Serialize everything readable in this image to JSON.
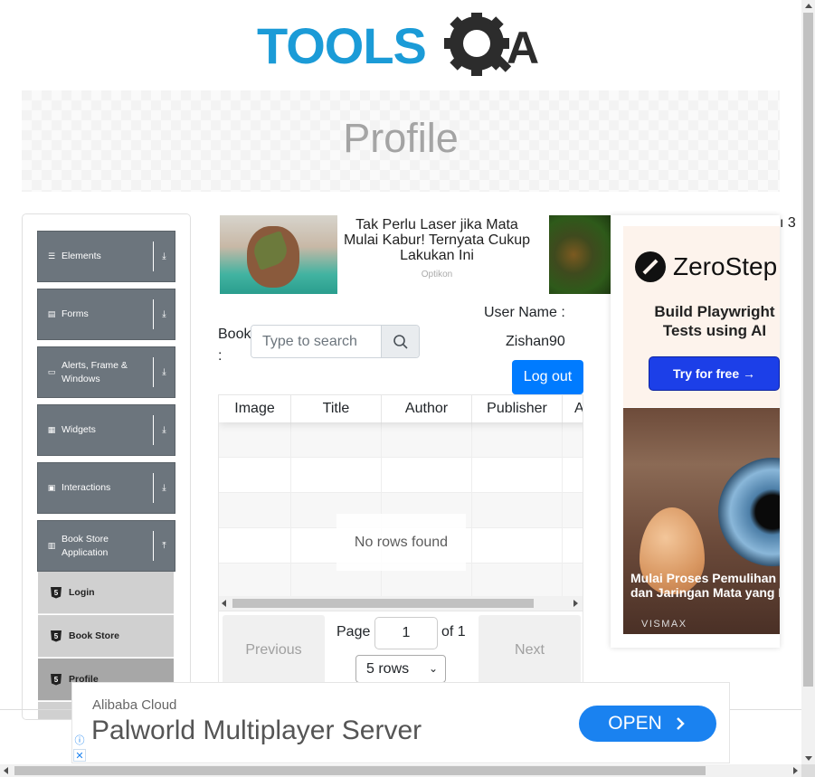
{
  "brand": {
    "logo_text_part1": "TOOLS",
    "logo_text_part2": "QA",
    "logo_color_primary": "#1b9bd7",
    "logo_color_gear": "#2c2c2c"
  },
  "page": {
    "title": "Profile"
  },
  "sidebar": {
    "groups": [
      {
        "label": "Elements",
        "icon": "menu-lines-icon",
        "arrow": "download-arrow-icon"
      },
      {
        "label": "Forms",
        "icon": "form-icon",
        "arrow": "download-arrow-icon"
      },
      {
        "label": "Alerts, Frame & Windows",
        "icon": "window-icon",
        "arrow": "download-arrow-icon"
      },
      {
        "label": "Widgets",
        "icon": "grid-icon",
        "arrow": "download-arrow-icon"
      },
      {
        "label": "Interactions",
        "icon": "box-icon",
        "arrow": "download-arrow-icon"
      },
      {
        "label": "Book Store Application",
        "icon": "books-icon",
        "arrow": "upload-arrow-icon"
      }
    ],
    "book_store_items": [
      {
        "label": "Login",
        "active": false
      },
      {
        "label": "Book Store",
        "active": false
      },
      {
        "label": "Profile",
        "active": true
      }
    ]
  },
  "top_ad": {
    "headline": "Tak Perlu Laser jika Mata Mulai Kabur! Ternyata Cukup Lakukan Ini",
    "source": "Optikon",
    "partial_edge_text": "3"
  },
  "profile": {
    "books_label": "Book :",
    "search_placeholder": "Type to search",
    "user_name_label": "User Name :",
    "user_name_value": "Zishan90",
    "logout_label": "Log out"
  },
  "table": {
    "columns": [
      "Image",
      "Title",
      "Author",
      "Publisher",
      "A"
    ],
    "rows": [],
    "empty_message": "No rows found"
  },
  "pagination": {
    "previous_label": "Previous",
    "next_label": "Next",
    "page_label": "Page",
    "page_value": "1",
    "of_label": "of 1",
    "rows_selected": "5 rows"
  },
  "right_ad": {
    "brand": "ZeroStep",
    "tagline": "Build Playwright Tests using AI",
    "cta": "Try for free →",
    "image_caption_line1": "Mulai Proses Pemulihan Per",
    "image_caption_line2": "dan Jaringan Mata yang Rus",
    "image_brand": "VISMAX"
  },
  "bottom_ad": {
    "brand": "Alibaba Cloud",
    "title": "Palworld Multiplayer Server",
    "cta": "OPEN",
    "info_icon": "info-icon",
    "close_icon": "close-icon"
  }
}
